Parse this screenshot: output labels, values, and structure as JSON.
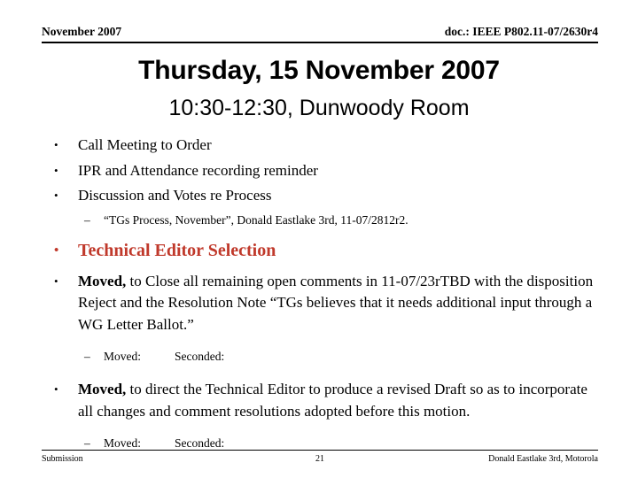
{
  "header": {
    "left": "November 2007",
    "right": "doc.: IEEE P802.11-07/2630r4"
  },
  "title": "Thursday, 15 November 2007",
  "subtitle": "10:30-12:30, Dunwoody Room",
  "bullet_marker": "•",
  "dash_marker": "–",
  "accent_color": "#C0392B",
  "body": {
    "items": [
      {
        "text": "Call Meeting to Order"
      },
      {
        "text": "IPR and Attendance recording reminder"
      },
      {
        "text": "Discussion and Votes re Process"
      }
    ],
    "sub_reference": "“TGs Process, November”, Donald Eastlake 3rd, 11-07/2812r2.",
    "highlight": "Technical Editor Selection",
    "motion_one": {
      "lead": "Moved,",
      "text": " to Close all remaining open comments in 11-07/23rTBD with the disposition Reject and the Resolution Note “TGs believes that it needs additional input through a WG Letter Ballot.”"
    },
    "motion_one_vote": {
      "moved_label": "Moved:",
      "seconded_label": "Seconded:"
    },
    "motion_two": {
      "lead": "Moved,",
      "text": " to direct the Technical Editor to produce a revised Draft so as to incorporate all changes and comment resolutions adopted before this motion."
    },
    "motion_two_vote": {
      "moved_label": "Moved:",
      "seconded_label": "Seconded:"
    }
  },
  "footer": {
    "left": "Submission",
    "page": "21",
    "right": "Donald Eastlake 3rd, Motorola"
  }
}
